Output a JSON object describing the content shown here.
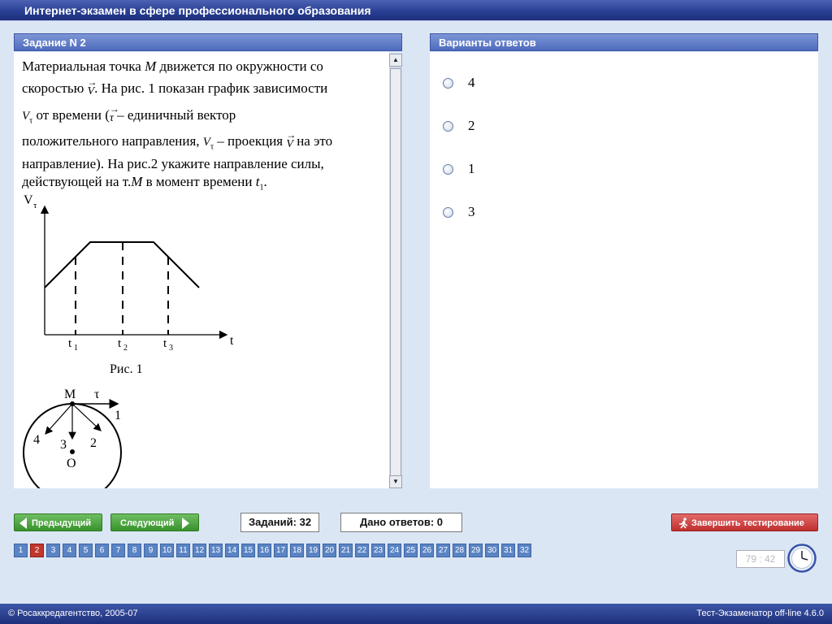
{
  "window": {
    "title": "Интернет-экзамен в сфере профессионального образования"
  },
  "question": {
    "header": "Задание N 2",
    "lines": {
      "l1a": "Материальная точка ",
      "l1m": "M",
      "l1b": " движется по окружности со",
      "l2a": "скоростью ",
      "l2v": "V",
      "l2b": ". На рис. 1 показан график зависимости",
      "l3v": "V",
      "l3sub": "τ",
      "l3a": " от времени (",
      "l3t": "τ",
      "l3b": " – единичный вектор",
      "l4a": "положительного направления, ",
      "l4v": "V",
      "l4sub": "τ",
      "l4b": " – проекция ",
      "l4vv": "V",
      "l4c": " на это",
      "l5": "направление). На рис.2 укажите направление силы,",
      "l6a": "действующей на т.",
      "l6m": "M",
      "l6b": " в момент времени ",
      "l6t": "t",
      "l6sub": "1",
      "l6c": "."
    },
    "fig1": {
      "y_axis_label": "V",
      "y_axis_sub": "τ",
      "x_axis_label": "t",
      "ticks": [
        {
          "label": "t",
          "sub": "1"
        },
        {
          "label": "t",
          "sub": "2"
        },
        {
          "label": "t",
          "sub": "3"
        }
      ],
      "caption": "Рис. 1"
    },
    "fig2": {
      "point_label": "M",
      "tangent_label": "τ",
      "center_label": "O",
      "arrow_labels": [
        "1",
        "2",
        "3",
        "4"
      ]
    }
  },
  "answers": {
    "header": "Варианты ответов",
    "options": [
      "4",
      "2",
      "1",
      "3"
    ]
  },
  "nav": {
    "prev_label": "Предыдущий",
    "next_label": "Следующий",
    "tasks_label": "Заданий: 32",
    "answered_label": "Дано ответов: 0",
    "finish_label": "Завершить тестирование"
  },
  "pager": {
    "pages": [
      "1",
      "2",
      "3",
      "4",
      "5",
      "6",
      "7",
      "8",
      "9",
      "10",
      "11",
      "12",
      "13",
      "14",
      "15",
      "16",
      "17",
      "18",
      "19",
      "20",
      "21",
      "22",
      "23",
      "24",
      "25",
      "26",
      "27",
      "28",
      "29",
      "30",
      "31",
      "32"
    ],
    "current": "2"
  },
  "timer": {
    "value": "79 : 42"
  },
  "footer": {
    "copyright": "© Росаккредагентство, 2005-07",
    "version": "Тест-Экзаменатор off-line 4.6.0"
  },
  "colors": {
    "accent": "#263d92",
    "pager": "#5a84c4",
    "current_page": "#c0372d",
    "finish": "#bf2e2e",
    "nav_buttons": "#37922b"
  },
  "icons": {
    "clock": "clock-icon",
    "finish": "running-man-icon",
    "prev": "arrow-left-icon",
    "next": "arrow-right-icon"
  }
}
